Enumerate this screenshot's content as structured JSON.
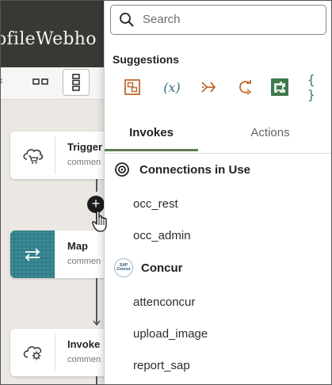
{
  "canvas": {
    "header_title": "ofileWebho",
    "nodes": [
      {
        "title": "Trigger",
        "subtitle": "commen",
        "icon": "cloud-cart-icon"
      },
      {
        "title": "Map",
        "subtitle": "commen",
        "icon": "map-arrows-icon"
      },
      {
        "title": "Invoke",
        "subtitle": "commen",
        "icon": "cloud-gear-icon"
      }
    ],
    "add_button": "+"
  },
  "panel": {
    "search": {
      "placeholder": "Search",
      "value": ""
    },
    "suggestions": {
      "label": "Suggestions",
      "items": [
        {
          "name": "map-action-icon"
        },
        {
          "name": "assign-variable-icon",
          "glyph": "(x)"
        },
        {
          "name": "switch-action-icon"
        },
        {
          "name": "for-each-icon"
        },
        {
          "name": "integration-icon"
        },
        {
          "name": "json-action-icon",
          "glyph": "{ }"
        }
      ]
    },
    "tabs": [
      {
        "label": "Invokes",
        "active": true
      },
      {
        "label": "Actions",
        "active": false
      }
    ],
    "sections": [
      {
        "title": "Connections in Use",
        "icon": "target-icon",
        "items": [
          "occ_rest",
          "occ_admin"
        ]
      },
      {
        "title": "Concur",
        "icon": "sap-concur-logo",
        "logo_text": [
          "SAP",
          "Concur"
        ],
        "items": [
          "attenconcur",
          "upload_image",
          "report_sap"
        ]
      }
    ]
  },
  "colors": {
    "accent_green": "#5e7c4d",
    "icon_orange": "#c06a2e",
    "icon_teal": "#2e6f80",
    "icon_green": "#3f7a4c",
    "map_tile": "#2f7f8a"
  }
}
